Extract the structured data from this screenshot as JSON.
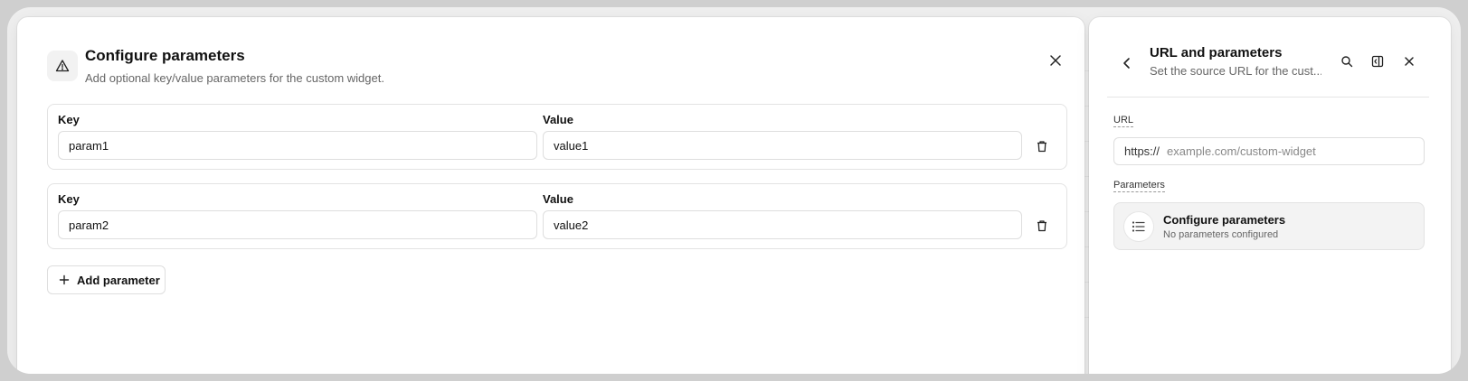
{
  "modal": {
    "title": "Configure parameters",
    "subtitle": "Add optional key/value parameters for the custom widget.",
    "key_label": "Key",
    "value_label": "Value",
    "rows": [
      {
        "key": "param1",
        "value": "value1"
      },
      {
        "key": "param2",
        "value": "value2"
      }
    ],
    "add_button_label": "Add parameter"
  },
  "panel": {
    "title": "URL and parameters",
    "subtitle": "Set the source URL for the cust...",
    "url_label": "URL",
    "url_prefix": "https://",
    "url_placeholder": "example.com/custom-widget",
    "parameters_label": "Parameters",
    "card_title": "Configure parameters",
    "card_subtitle": "No parameters configured"
  },
  "icons": {
    "modal_icon": "warning-triangle-icon",
    "close": "close-icon",
    "trash": "trash-icon",
    "add": "plus-icon",
    "back": "chevron-left-icon",
    "search": "search-icon",
    "panel_toggle": "panel-collapse-icon",
    "list": "list-icon"
  }
}
